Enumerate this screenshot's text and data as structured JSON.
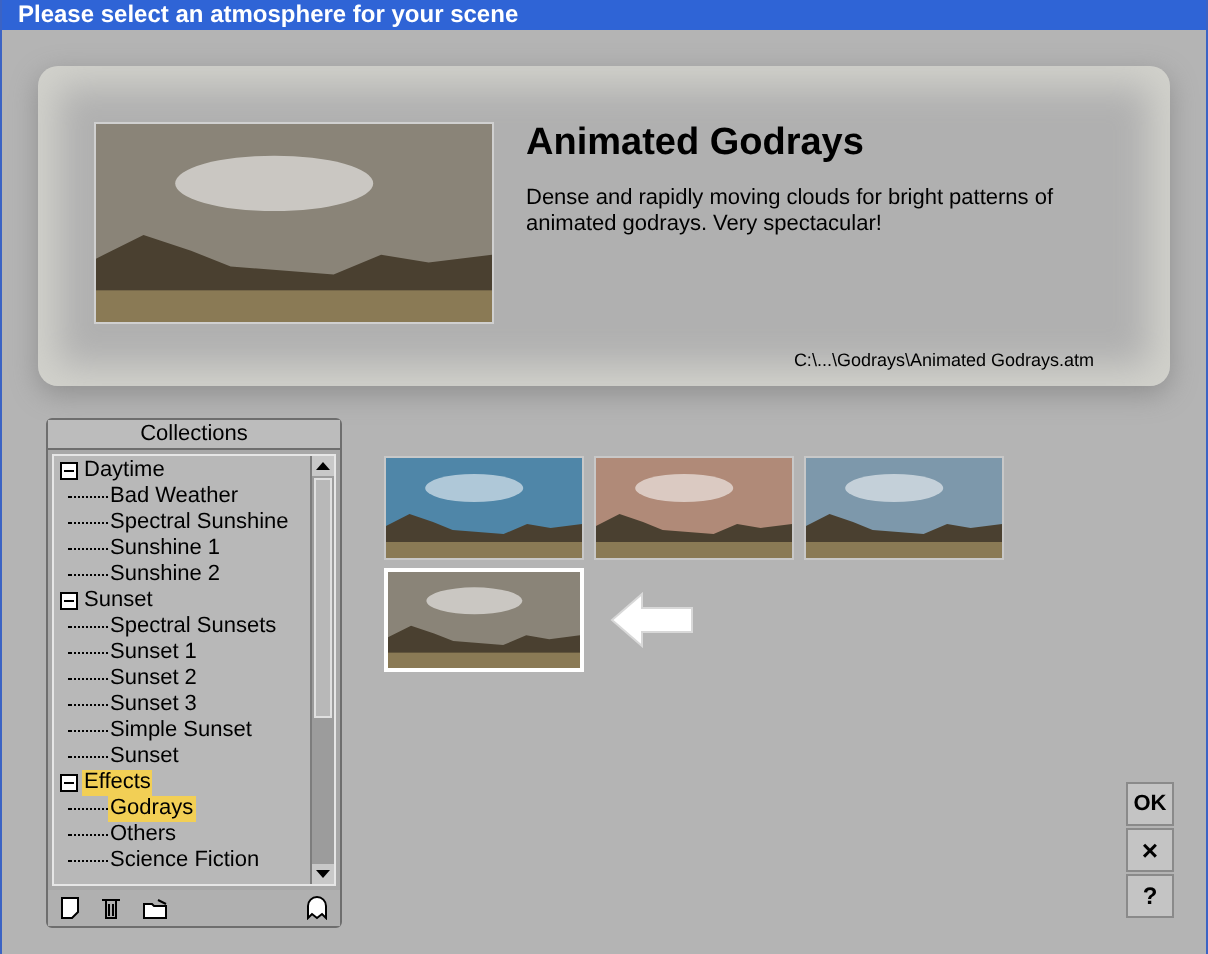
{
  "window": {
    "title": "Please select an atmosphere for your scene"
  },
  "preview": {
    "title": "Animated Godrays",
    "description": "Dense and rapidly moving clouds for bright patterns of animated godrays. Very spectacular!",
    "path": "C:\\...\\Godrays\\Animated Godrays.atm"
  },
  "collections": {
    "header": "Collections",
    "items": [
      {
        "label": "Daytime",
        "expanded": true,
        "selected": false,
        "children": [
          {
            "label": "Bad Weather",
            "selected": false
          },
          {
            "label": "Spectral Sunshine",
            "selected": false
          },
          {
            "label": "Sunshine 1",
            "selected": false
          },
          {
            "label": "Sunshine 2",
            "selected": false
          }
        ]
      },
      {
        "label": "Sunset",
        "expanded": true,
        "selected": false,
        "children": [
          {
            "label": "Spectral Sunsets",
            "selected": false
          },
          {
            "label": "Sunset 1",
            "selected": false
          },
          {
            "label": "Sunset 2",
            "selected": false
          },
          {
            "label": "Sunset 3",
            "selected": false
          },
          {
            "label": "Simple Sunset",
            "selected": false
          },
          {
            "label": "Sunset",
            "selected": false
          }
        ]
      },
      {
        "label": "Effects",
        "expanded": true,
        "selected": true,
        "children": [
          {
            "label": "Godrays",
            "selected": true
          },
          {
            "label": "Others",
            "selected": false
          },
          {
            "label": "Science Fiction",
            "selected": false
          }
        ]
      }
    ]
  },
  "thumbnails": [
    {
      "selected": false,
      "color": "#4f86a8"
    },
    {
      "selected": false,
      "color": "#b08a78"
    },
    {
      "selected": false,
      "color": "#7d98ab"
    },
    {
      "selected": true,
      "color": "#8a8478"
    }
  ],
  "buttons": [
    {
      "kind": "ok",
      "label": "OK"
    },
    {
      "kind": "close",
      "label": "×"
    },
    {
      "kind": "help",
      "label": "?"
    }
  ]
}
